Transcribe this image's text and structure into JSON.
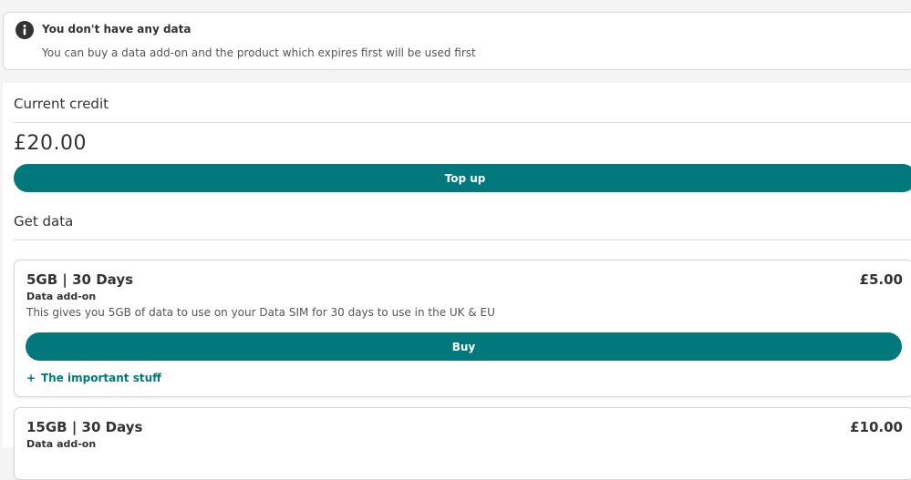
{
  "notice": {
    "title": "You don't have any data",
    "message": "You can buy a data add-on and the product which expires first will be used first",
    "icon": "info-icon"
  },
  "credit": {
    "heading": "Current credit",
    "amount": "£20.00",
    "top_up_label": "Top up"
  },
  "get_data": {
    "heading": "Get data",
    "products": [
      {
        "title": "5GB | 30 Days",
        "price": "£5.00",
        "type": "Data add-on",
        "description": "This gives you 5GB of data to use on your Data SIM for 30 days to use in the UK & EU",
        "buy_label": "Buy",
        "details_label": "The important stuff"
      },
      {
        "title": "15GB | 30 Days",
        "price": "£10.00",
        "type": "Data add-on"
      }
    ]
  },
  "colors": {
    "accent": "#00787c",
    "text": "#333333",
    "background": "#f4f4f4"
  }
}
